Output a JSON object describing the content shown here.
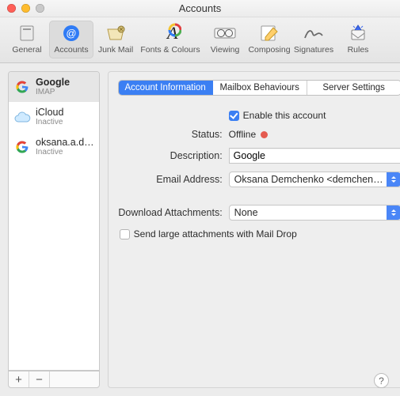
{
  "window": {
    "title": "Accounts"
  },
  "toolbar": {
    "items": [
      {
        "label": "General"
      },
      {
        "label": "Accounts"
      },
      {
        "label": "Junk Mail"
      },
      {
        "label": "Fonts & Colours"
      },
      {
        "label": "Viewing"
      },
      {
        "label": "Composing"
      },
      {
        "label": "Signatures"
      },
      {
        "label": "Rules"
      }
    ],
    "selected_index": 1
  },
  "accounts": {
    "items": [
      {
        "name": "Google",
        "sub": "IMAP"
      },
      {
        "name": "iCloud",
        "sub": "Inactive"
      },
      {
        "name": "oksana.a.d…",
        "sub": "Inactive"
      }
    ],
    "selected_index": 0,
    "footer_add": "+",
    "footer_remove": "−"
  },
  "tabs": {
    "items": [
      "Account Information",
      "Mailbox Behaviours",
      "Server Settings"
    ],
    "selected_index": 0
  },
  "form": {
    "enable_label": "Enable this account",
    "enable_checked": true,
    "status_label": "Status:",
    "status_value": "Offline",
    "description_label": "Description:",
    "description_value": "Google",
    "email_label": "Email Address:",
    "email_value": "Oksana Demchenko <demchen…",
    "download_label": "Download Attachments:",
    "download_value": "None",
    "maildrop_label": "Send large attachments with Mail Drop",
    "maildrop_checked": false
  },
  "help_glyph": "?"
}
